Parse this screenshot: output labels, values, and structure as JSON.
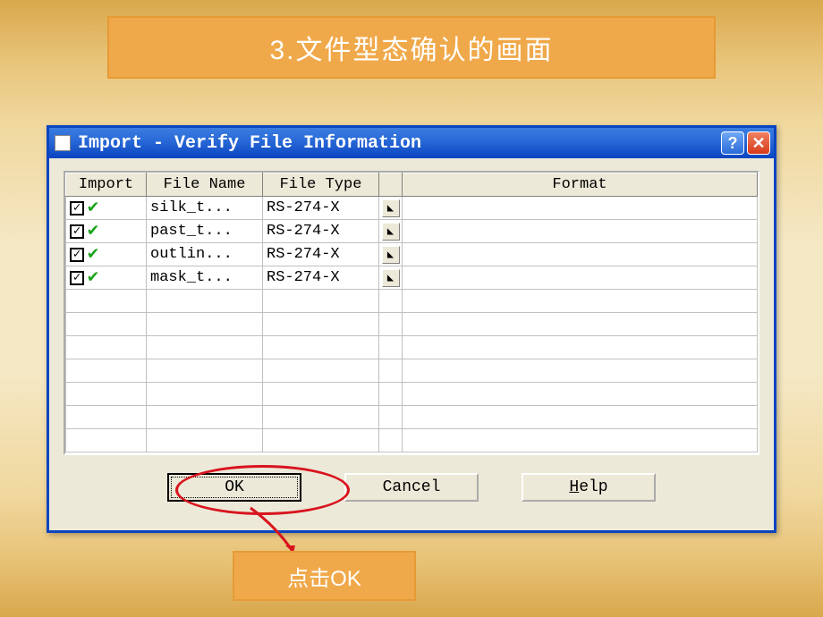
{
  "banner": {
    "title": "3.文件型态确认的画面"
  },
  "dialog": {
    "title": "Import - Verify File Information",
    "help_glyph": "?",
    "close_glyph": "✕",
    "columns": {
      "import": "Import",
      "file_name": "File Name",
      "file_type": "File Type",
      "format": "Format"
    },
    "rows": [
      {
        "checked": "☑",
        "ok": "✔",
        "file_name": "silk_t...",
        "file_type": "RS-274-X",
        "format": ""
      },
      {
        "checked": "☑",
        "ok": "✔",
        "file_name": "past_t...",
        "file_type": "RS-274-X",
        "format": ""
      },
      {
        "checked": "☑",
        "ok": "✔",
        "file_name": "outlin...",
        "file_type": "RS-274-X",
        "format": ""
      },
      {
        "checked": "☑",
        "ok": "✔",
        "file_name": "mask_t...",
        "file_type": "RS-274-X",
        "format": ""
      }
    ],
    "empty_rows": 7,
    "buttons": {
      "ok": "OK",
      "cancel": "Cancel",
      "help": "Help"
    }
  },
  "callout": {
    "text": "点击OK"
  }
}
